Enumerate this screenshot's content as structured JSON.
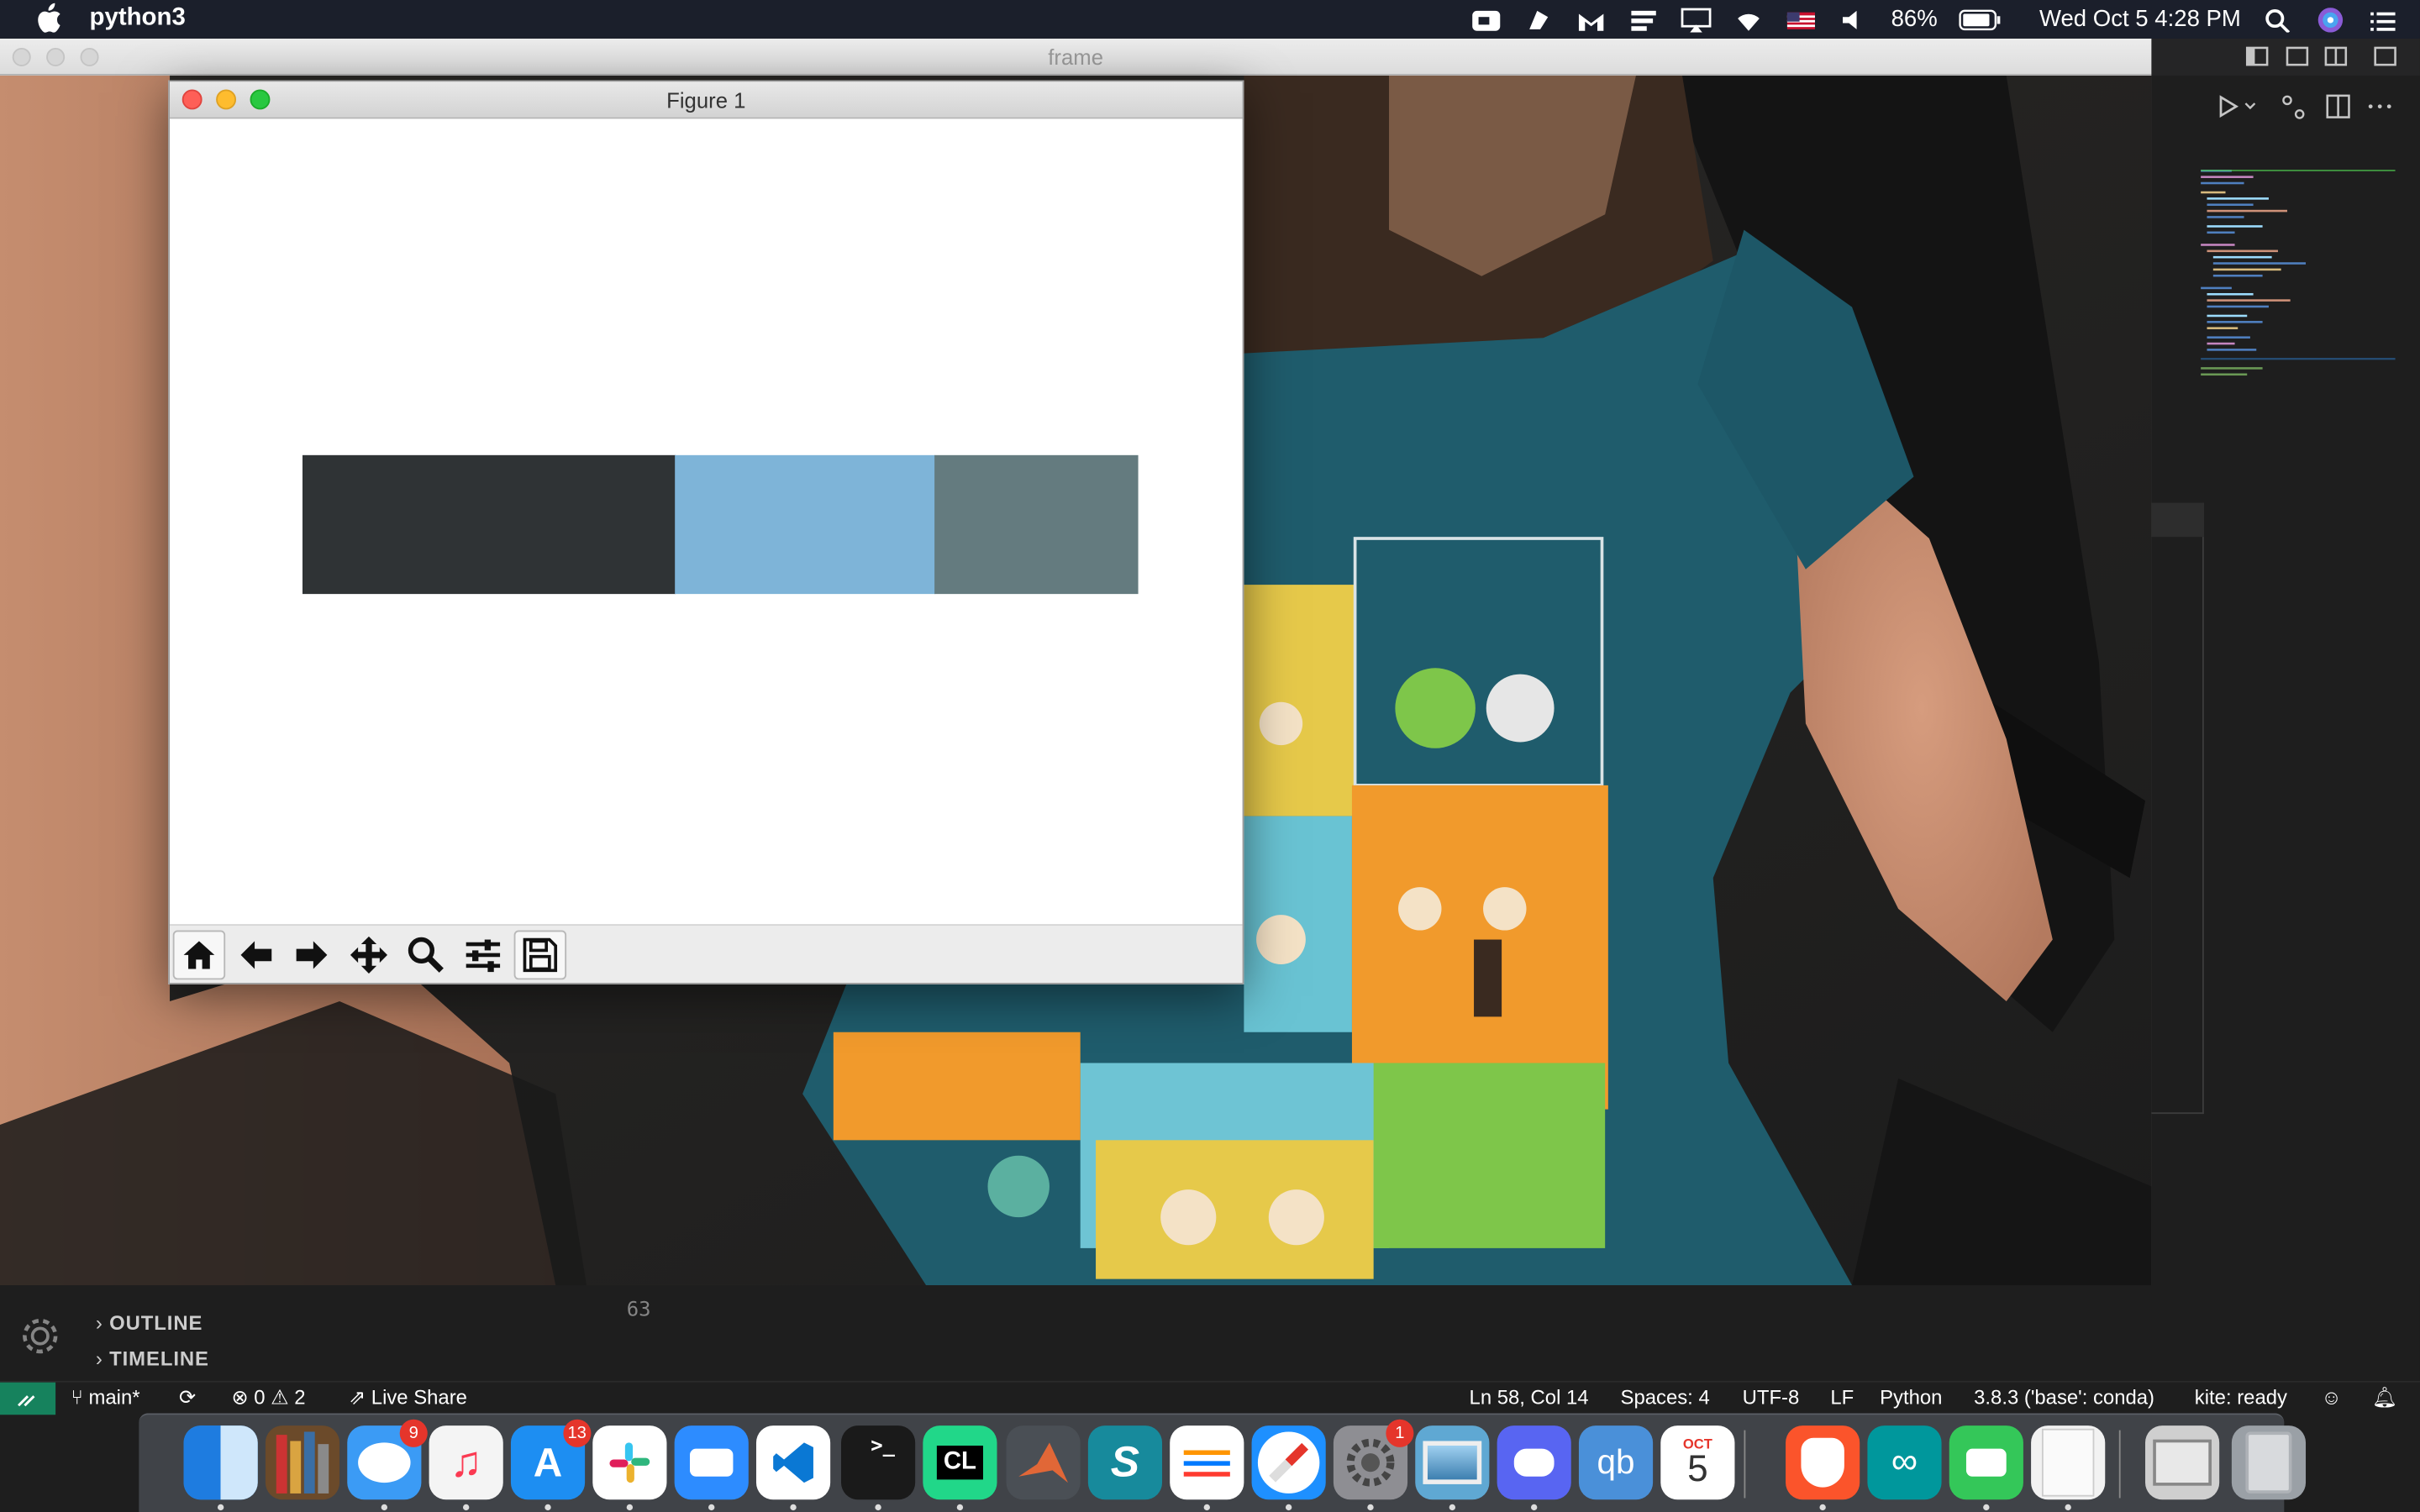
{
  "menubar": {
    "app_name": "python3",
    "battery": "86%",
    "datetime": "Wed Oct 5  4:28 PM",
    "icons": [
      "zoom-icon",
      "notes-icon",
      "malwarebytes-icon",
      "stacks-icon",
      "airplay-icon",
      "wifi-icon",
      "us-flag-icon",
      "volume-icon",
      "battery-icon",
      "spotlight-icon",
      "siri-icon",
      "control-center-icon"
    ]
  },
  "frame_window": {
    "title": "frame"
  },
  "figure_window": {
    "title": "Figure 1",
    "toolbar": [
      "home-button",
      "back-button",
      "forward-button",
      "pan-button",
      "zoom-button",
      "subplots-button",
      "save-button"
    ]
  },
  "chart_data": {
    "type": "bar",
    "orientation": "horizontal-stacked",
    "title": "",
    "xlabel": "",
    "ylabel": "",
    "axes_visible": false,
    "segments": [
      {
        "value": 0.446,
        "color": "#2f3335"
      },
      {
        "value": 0.311,
        "color": "#7eb4d8"
      },
      {
        "value": 0.243,
        "color": "#647b7f"
      }
    ]
  },
  "vscode": {
    "outline_label": "OUTLINE",
    "timeline_label": "TIMELINE",
    "line_number": "63"
  },
  "statusbar": {
    "branch": "main*",
    "errors": "0",
    "warnings": "2",
    "live_share": "Live Share",
    "cursor": "Ln 58, Col 14",
    "spaces": "Spaces: 4",
    "encoding": "UTF-8",
    "eol": "LF",
    "language": "Python",
    "interpreter": "3.8.3 ('base': conda)",
    "kite": "kite: ready"
  },
  "dock": {
    "apps": [
      {
        "name": "finder",
        "color": "#2a8fe8"
      },
      {
        "name": "calibre",
        "color": "#6b4a2a"
      },
      {
        "name": "messages",
        "color": "#3b9bf5",
        "badge": "9"
      },
      {
        "name": "music",
        "color": "#f4f4f4"
      },
      {
        "name": "app-store",
        "color": "#1d8ef2",
        "badge": "13"
      },
      {
        "name": "slack",
        "color": "#ffffff"
      },
      {
        "name": "zoom",
        "color": "#2d8cff"
      },
      {
        "name": "vscode",
        "color": "#ffffff"
      },
      {
        "name": "terminal",
        "color": "#1a1a1a"
      },
      {
        "name": "clion",
        "color": "#21d789"
      },
      {
        "name": "matlab",
        "color": "#4a4f55"
      },
      {
        "name": "surfshark",
        "color": "#178a9c"
      },
      {
        "name": "reminders",
        "color": "#ffffff"
      },
      {
        "name": "safari",
        "color": "#1e90ff"
      },
      {
        "name": "system-preferences",
        "color": "#8e8e93",
        "badge": "1"
      },
      {
        "name": "preview",
        "color": "#5fa8d3"
      },
      {
        "name": "discord",
        "color": "#5865f2"
      },
      {
        "name": "qbittorrent",
        "color": "#4a90d9"
      },
      {
        "name": "calendar",
        "color": "#ffffff"
      },
      {
        "name": "brave",
        "color": "#fb542b"
      },
      {
        "name": "arduino",
        "color": "#00979c"
      },
      {
        "name": "facetime",
        "color": "#34c759"
      },
      {
        "name": "document",
        "color": "#f2f2f2"
      },
      {
        "name": "printer",
        "color": "#cfcfcf"
      },
      {
        "name": "trash",
        "color": "#9aa0a6"
      }
    ],
    "calendar_month": "OCT",
    "calendar_day": "5",
    "terminal_glyph": ">_",
    "clion_label": "CL",
    "qbittorrent_label": "qb"
  }
}
